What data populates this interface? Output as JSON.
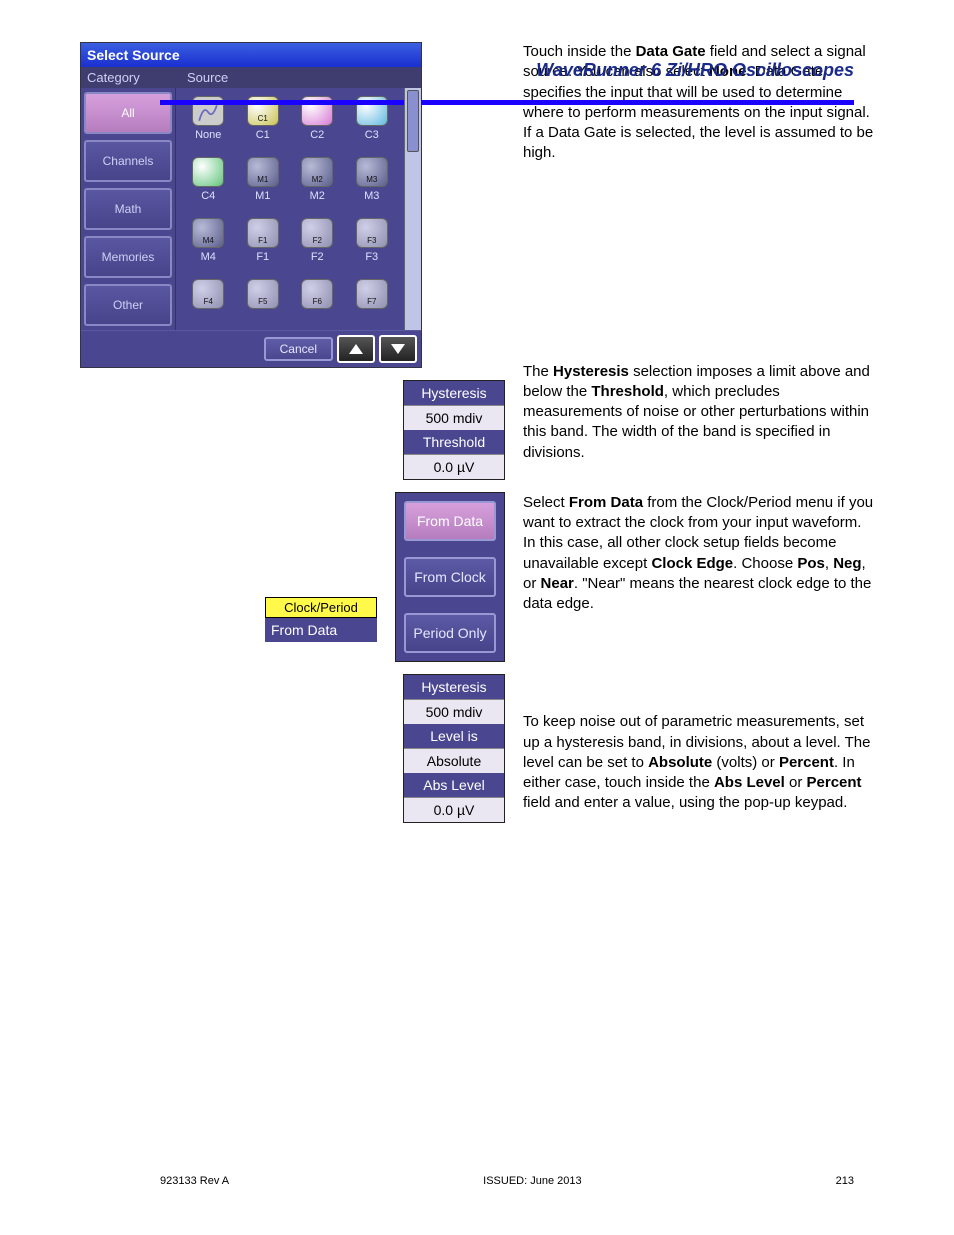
{
  "header": {
    "line1": "WaveRunner 6 Zi/HRO Oscilloscopes"
  },
  "select_source": {
    "title": "Select Source",
    "subheaders": {
      "category": "Category",
      "source": "Source"
    },
    "categories": [
      "All",
      "Channels",
      "Math",
      "Memories",
      "Other"
    ],
    "selected_category": 0,
    "sources_row1": [
      "None",
      "C1",
      "C2",
      "C3"
    ],
    "sources_row2": [
      "C4",
      "M1",
      "M2",
      "M3"
    ],
    "sources_row3": [
      "M4",
      "F1",
      "F2",
      "F3"
    ],
    "sources_row4": [
      "",
      "",
      "",
      ""
    ],
    "cancel": "Cancel"
  },
  "para1": {
    "t1": "Touch inside the ",
    "b1": "Data Gate",
    "t2": " field and select a signal source. You can also select ",
    "b2": "None",
    "t3": ". Data Gate specifies the input that will be used to determine where to perform measurements on the input signal. If a Data Gate is selected, the level is assumed to be high."
  },
  "hyst1": {
    "label": "Hysteresis",
    "value": "500 mdiv",
    "thresh_label": "Threshold",
    "thresh_value": "0.0 µV"
  },
  "para2": {
    "t1": "The ",
    "b1": "Hysteresis",
    "t2": " selection imposes a limit above and below the ",
    "b2": "Threshold",
    "t3": ", which precludes measurements of noise or other perturbations within this band. The width of the band is specified in divisions."
  },
  "clock_period": {
    "yellow": "Clock/Period",
    "value": "From Data",
    "options": [
      "From Data",
      "From Clock",
      "Period Only"
    ],
    "selected": 0
  },
  "para3": {
    "t1": "Select ",
    "b1": "From Data",
    "t2": " from the Clock/Period menu if you want to extract the clock from your input waveform. In this case, all other clock setup fields become unavailable except ",
    "b2": "Clock Edge",
    "t3": ". Choose ",
    "b3": "Pos",
    "t4": ", ",
    "b4": "Neg",
    "t5": ", or ",
    "b5": "Near",
    "t6": ". \"Near\" means the nearest clock edge to the data edge."
  },
  "hyst2": {
    "h_label": "Hysteresis",
    "h_value": "500 mdiv",
    "lvl_label": "Level is",
    "lvl_value": "Absolute",
    "abs_label": "Abs Level",
    "abs_value": "0.0 µV"
  },
  "para4": {
    "t1": "To keep noise out of parametric measurements, set up a hysteresis band, in divisions, about a level. The level can be set to ",
    "b1": "Absolute",
    "t2": " (volts) or ",
    "b2": "Percent",
    "t3": ". In either case, touch inside the ",
    "b3": "Abs Level",
    "t4": " or ",
    "b4": "Percent",
    "t5": " field and enter a value, using the pop-up keypad."
  },
  "footer": {
    "left": "923133 Rev A",
    "mid": "ISSUED: June 2013",
    "right": "213"
  }
}
